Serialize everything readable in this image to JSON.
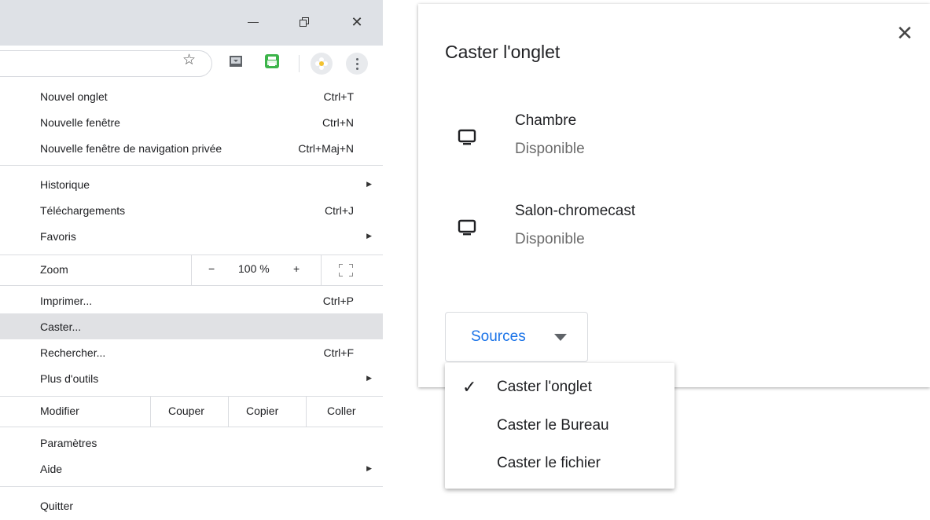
{
  "menu": {
    "items": [
      {
        "label": "Nouvel onglet",
        "shortcut": "Ctrl+T"
      },
      {
        "label": "Nouvelle fenêtre",
        "shortcut": "Ctrl+N"
      },
      {
        "label": "Nouvelle fenêtre de navigation privée",
        "shortcut": "Ctrl+Maj+N"
      },
      {
        "label": "Historique",
        "submenu": true
      },
      {
        "label": "Téléchargements",
        "shortcut": "Ctrl+J"
      },
      {
        "label": "Favoris",
        "submenu": true
      },
      {
        "label": "Imprimer...",
        "shortcut": "Ctrl+P"
      },
      {
        "label": "Caster...",
        "highlighted": true
      },
      {
        "label": "Rechercher...",
        "shortcut": "Ctrl+F"
      },
      {
        "label": "Plus d'outils",
        "submenu": true
      },
      {
        "label": "Paramètres"
      },
      {
        "label": "Aide",
        "submenu": true
      },
      {
        "label": "Quitter"
      }
    ],
    "zoom": {
      "label": "Zoom",
      "minus": "−",
      "value": "100 %",
      "plus": "+",
      "fullscreen_icon": "fullscreen-icon"
    },
    "edit": {
      "label": "Modifier",
      "cut": "Couper",
      "copy": "Copier",
      "paste": "Coller"
    }
  },
  "icons": {
    "star": "☆",
    "close": "✕",
    "minimize": "minimize-icon",
    "maximize": "restore-icon",
    "kebab": "more-vert-icon"
  },
  "cast_dialog": {
    "title": "Caster l'onglet",
    "close": "✕",
    "sinks": [
      {
        "name": "Chambre",
        "status": "Disponible"
      },
      {
        "name": "Salon-chromecast",
        "status": "Disponible"
      }
    ],
    "sources_label": "Sources",
    "sources_menu": [
      {
        "label": "Caster l'onglet",
        "checked": true,
        "check": "✓"
      },
      {
        "label": "Caster le Bureau",
        "checked": false
      },
      {
        "label": "Caster le fichier",
        "checked": false
      }
    ]
  },
  "colors": {
    "accent": "#1a73e8",
    "highlight": "#e0e1e4",
    "titlebar": "#dee1e6"
  }
}
